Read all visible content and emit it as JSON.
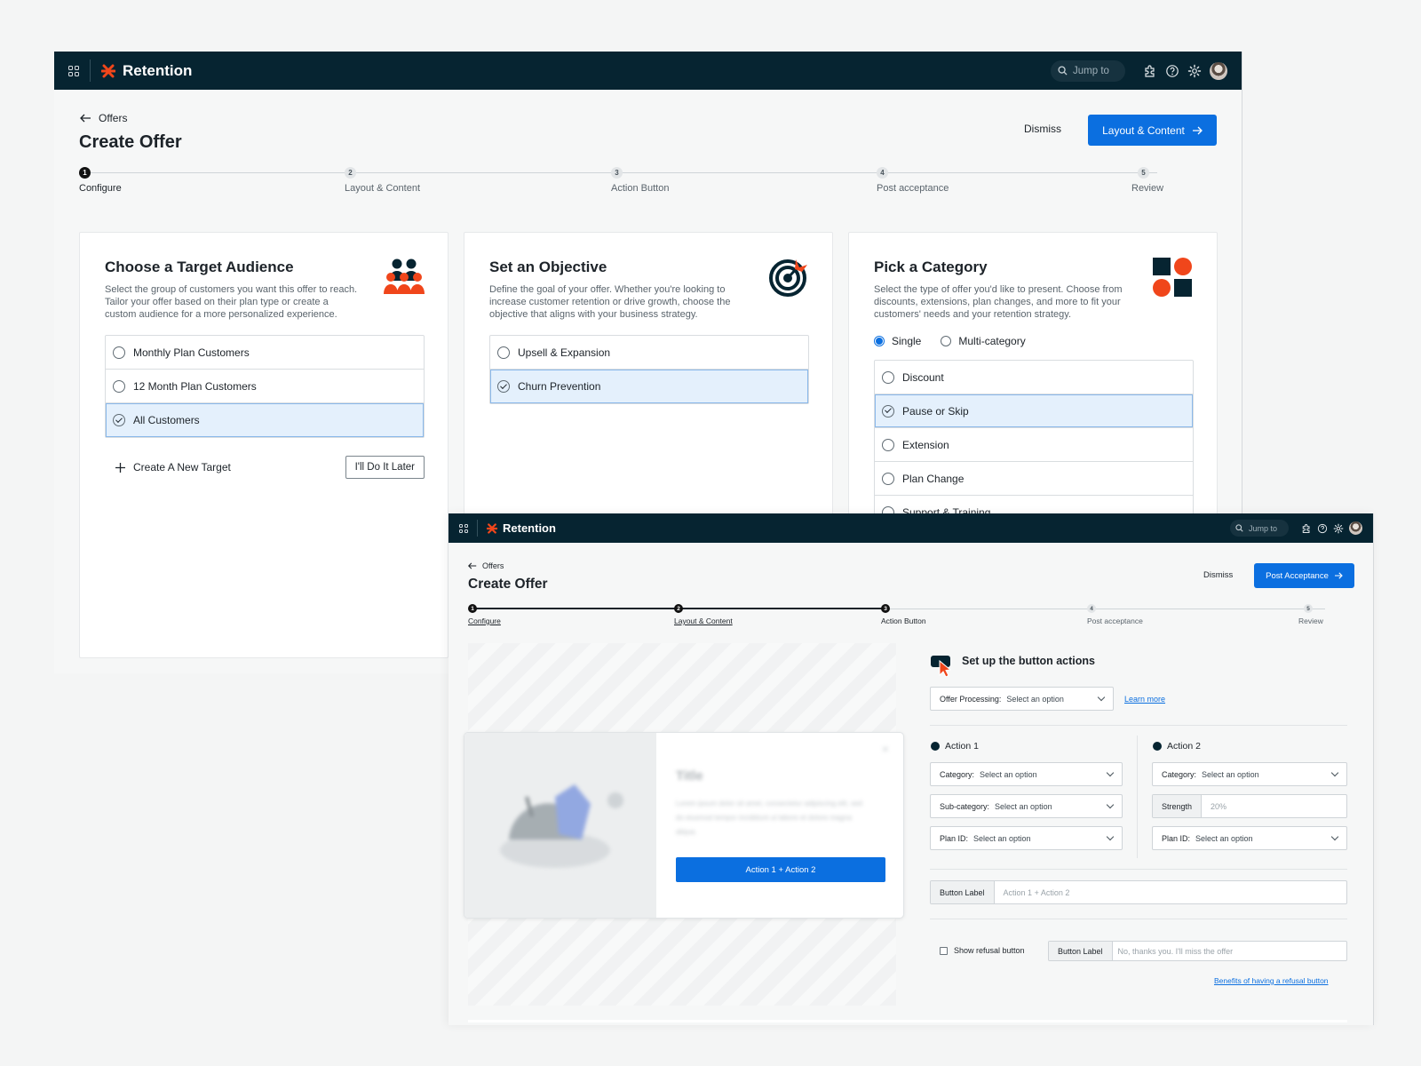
{
  "colors": {
    "nav_bg": "#062431",
    "accent": "#0b6fe0",
    "brand_red": "#f0461b",
    "selected_bg": "#e4f0fc"
  },
  "window1": {
    "app": {
      "brand": "Retention",
      "search_placeholder": "Jump to"
    },
    "breadcrumb": "Offers",
    "title": "Create Offer",
    "dismiss_label": "Dismiss",
    "next_label": "Layout & Content",
    "steps": [
      {
        "num": "1",
        "label": "Configure",
        "state": "active"
      },
      {
        "num": "2",
        "label": "Layout & Content",
        "state": "todo"
      },
      {
        "num": "3",
        "label": "Action Button",
        "state": "todo"
      },
      {
        "num": "4",
        "label": "Post acceptance",
        "state": "todo"
      },
      {
        "num": "5",
        "label": "Review",
        "state": "todo"
      }
    ],
    "audience": {
      "title": "Choose a Target Audience",
      "desc": "Select the group of customers you want this offer to reach. Tailor your offer based on their plan type or create a custom audience for a more personalized experience.",
      "options": [
        "Monthly Plan Customers",
        "12 Month Plan Customers",
        "All Customers"
      ],
      "selected": 2,
      "create_label": "Create A New Target",
      "later_label": "I'll Do It Later"
    },
    "objective": {
      "title": "Set an Objective",
      "desc": "Define the goal of your offer. Whether you're looking to increase customer retention or drive growth, choose the objective that aligns with your business strategy.",
      "options": [
        "Upsell & Expansion",
        "Churn Prevention"
      ],
      "selected": 1
    },
    "category": {
      "title": "Pick a Category",
      "desc": "Select the type of offer you'd like to present. Choose from discounts, extensions, plan changes, and more to fit your customers' needs and your retention strategy.",
      "mode_single": "Single",
      "mode_multi": "Multi-category",
      "options": [
        "Discount",
        "Pause or Skip",
        "Extension",
        "Plan Change",
        "Support & Training"
      ],
      "selected": 1
    }
  },
  "window2": {
    "app": {
      "brand": "Retention",
      "search_placeholder": "Jump to"
    },
    "breadcrumb": "Offers",
    "title": "Create Offer",
    "dismiss_label": "Dismiss",
    "next_label": "Post Acceptance",
    "steps": [
      {
        "num": "1",
        "label": "Configure",
        "state": "done"
      },
      {
        "num": "2",
        "label": "Layout & Content",
        "state": "done"
      },
      {
        "num": "3",
        "label": "Action Button",
        "state": "active"
      },
      {
        "num": "4",
        "label": "Post acceptance",
        "state": "todo"
      },
      {
        "num": "5",
        "label": "Review",
        "state": "todo"
      }
    ],
    "preview": {
      "title": "Title",
      "body": "Lorem ipsum dolor sit amet, consectetur adipiscing elit, sed do eiusmod tempor incididunt ut labore et dolore magna aliqua.",
      "button_label": "Action 1 + Action 2"
    },
    "setup": {
      "heading": "Set up the button actions",
      "processing_key": "Offer Processing:",
      "processing_value": "Select an option",
      "learn_more": "Learn more",
      "action1": {
        "title": "Action 1",
        "category_key": "Category:",
        "category_value": "Select an option",
        "subcategory_key": "Sub-category:",
        "subcategory_value": "Select an option",
        "plan_key": "Plan ID:",
        "plan_value": "Select an option"
      },
      "action2": {
        "title": "Action 2",
        "category_key": "Category:",
        "category_value": "Select an option",
        "strength_key": "Strength",
        "strength_placeholder": "20%",
        "plan_key": "Plan ID:",
        "plan_value": "Select an option"
      },
      "button_label_key": "Button Label",
      "button_label_placeholder": "Action 1 + Action 2",
      "refusal_checkbox": "Show refusal button",
      "refusal_label_key": "Button Label",
      "refusal_label_placeholder": "No, thanks you. I'll miss the offer",
      "refusal_link": "Benefits of having a refusal button"
    }
  }
}
